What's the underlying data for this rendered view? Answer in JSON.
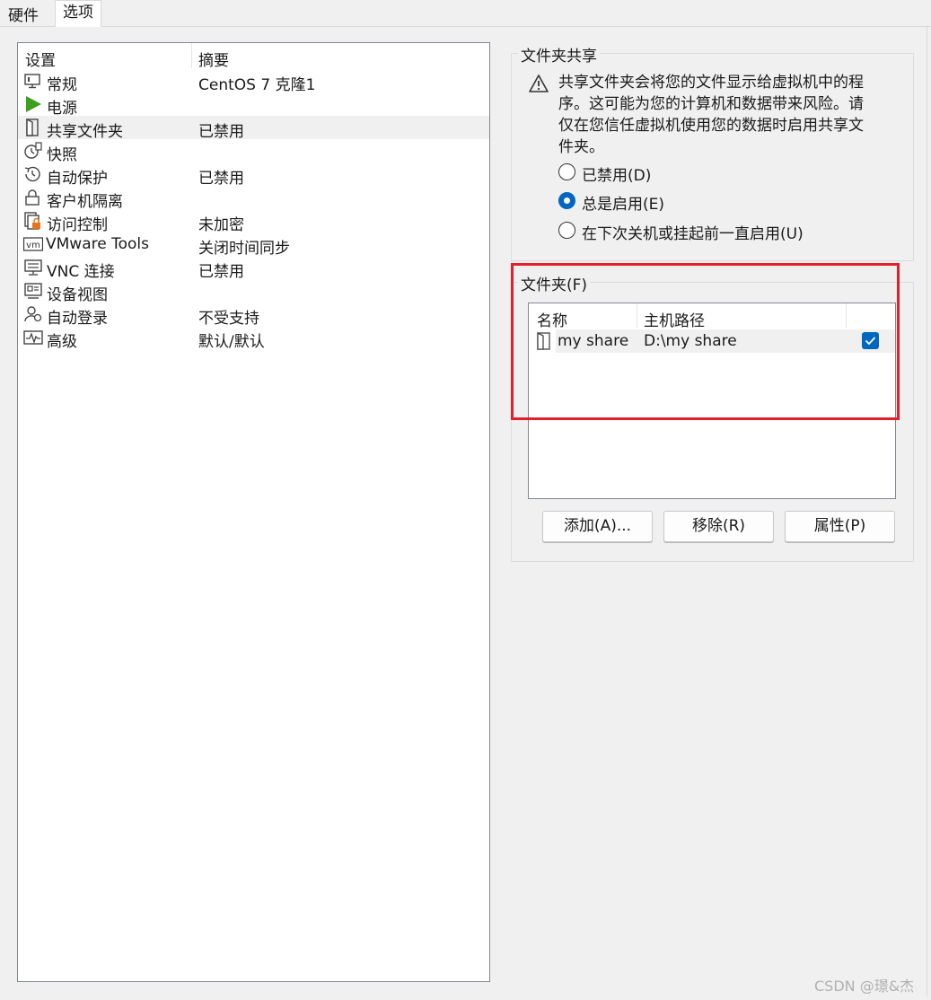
{
  "tabs": [
    {
      "label": "硬件"
    },
    {
      "label": "选项"
    }
  ],
  "settings": {
    "header": {
      "setting": "设置",
      "summary": "摘要"
    },
    "items": [
      {
        "name": "常规",
        "summary": "CentOS 7 克隆1",
        "icon": "monitor-icon"
      },
      {
        "name": "电源",
        "summary": "",
        "icon": "power-play-icon"
      },
      {
        "name": "共享文件夹",
        "summary": "已禁用",
        "icon": "shared-folder-icon"
      },
      {
        "name": "快照",
        "summary": "",
        "icon": "snapshot-clock-icon"
      },
      {
        "name": "自动保护",
        "summary": "已禁用",
        "icon": "autoprotect-clock-icon"
      },
      {
        "name": "客户机隔离",
        "summary": "",
        "icon": "lock-icon"
      },
      {
        "name": "访问控制",
        "summary": "未加密",
        "icon": "access-control-icon"
      },
      {
        "name": "VMware Tools",
        "summary": "关闭时间同步",
        "icon": "vm-icon"
      },
      {
        "name": "VNC 连接",
        "summary": "已禁用",
        "icon": "vnc-icon"
      },
      {
        "name": "设备视图",
        "summary": "",
        "icon": "device-view-icon"
      },
      {
        "name": "自动登录",
        "summary": "不受支持",
        "icon": "user-login-icon"
      },
      {
        "name": "高级",
        "summary": "默认/默认",
        "icon": "pulse-icon"
      }
    ]
  },
  "sharing": {
    "title": "文件夹共享",
    "warning": "共享文件夹会将您的文件显示给虚拟机中的程序。这可能为您的计算机和数据带来风险。请仅在您信任虚拟机使用您的数据时启用共享文件夹。",
    "options": [
      {
        "label": "已禁用(D)",
        "selected": false
      },
      {
        "label": "总是启用(E)",
        "selected": true
      },
      {
        "label": "在下次关机或挂起前一直启用(U)",
        "selected": false
      }
    ]
  },
  "folders": {
    "title": "文件夹(F)",
    "col_name": "名称",
    "col_path": "主机路径",
    "rows": [
      {
        "name": "my share",
        "path": "D:\\my share",
        "enabled": true
      }
    ]
  },
  "buttons": {
    "add": "添加(A)...",
    "remove": "移除(R)",
    "properties": "属性(P)"
  },
  "watermark": "CSDN @璟&杰",
  "colors": {
    "accent": "#0067c0",
    "highlight_border": "#e0202a",
    "power_green": "#3ca01e",
    "lock_orange": "#e8741c"
  }
}
